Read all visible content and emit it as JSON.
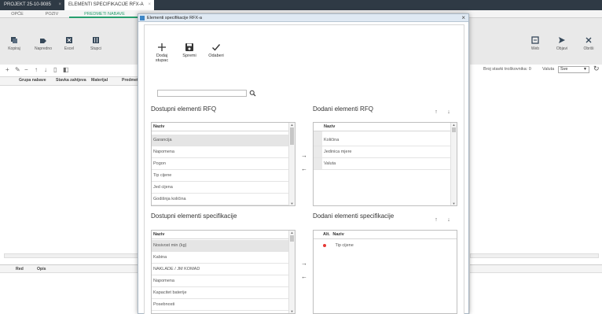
{
  "top_tabs": [
    {
      "label": "PROJEKT 25-10-9085",
      "close": "×"
    },
    {
      "label": "ELEMENTI SPECIFIKACIJE RFX-A",
      "close": "×"
    }
  ],
  "bg": {
    "sub_tabs": [
      "OPĆE",
      "POZIV",
      "PREDMETI NABAVE"
    ],
    "toolbar_left": [
      "Kopiraj",
      "Napredno",
      "Excel",
      "Stupci"
    ],
    "toolbar_right": [
      "Web",
      "Objavi",
      "Obriši"
    ],
    "columns": [
      "Grupa nabave",
      "Stavka zahtjeva",
      "Materijal",
      "Predmet"
    ],
    "row_count_label": "Broj stavki troškovnika: 0",
    "currency_label": "Valuta",
    "currency_value": "Sve",
    "lower_columns": [
      "Red",
      "Opis"
    ]
  },
  "modal": {
    "title": "Elementi specifikacije RFX-a",
    "close": "×",
    "toolbar": [
      {
        "label": "Dodaj stupac",
        "icon": "plus-icon"
      },
      {
        "label": "Spremi",
        "icon": "save-icon"
      },
      {
        "label": "Odaberi",
        "icon": "check-icon"
      }
    ],
    "search": {
      "value": "",
      "placeholder": ""
    },
    "available_rfq": {
      "title": "Dostupni elementi RFQ",
      "header": "Naziv",
      "items": [
        "Garancija",
        "Napomena",
        "Pogon",
        "Tip cijene",
        "Jed cijena",
        "Godišnja količina"
      ],
      "selected_index": 0
    },
    "added_rfq": {
      "title": "Dodani elementi RFQ",
      "header": "Naziv",
      "items": [
        "Količina",
        "Jedinica mjere",
        "Valuta"
      ]
    },
    "available_spec": {
      "title": "Dostupni elementi specifikacije",
      "header": "Naziv",
      "items": [
        "Nosivost min (kg)",
        "Kabina",
        "NAKLADE / JM KOMAD",
        "Napomena",
        "Kapacitet baterije",
        "Posebnosti"
      ],
      "selected_index": 0
    },
    "added_spec": {
      "title": "Dodani elementi specifikacije",
      "header_alt": "Alt.",
      "header": "Naziv",
      "items": [
        "Tip cijene"
      ]
    },
    "glyphs": {
      "right": "→",
      "left": "←",
      "up": "↑",
      "down": "↓"
    }
  },
  "colors": {
    "accent": "#27a06e",
    "topbar": "#2f3a45",
    "required_dot": "#e53935"
  }
}
